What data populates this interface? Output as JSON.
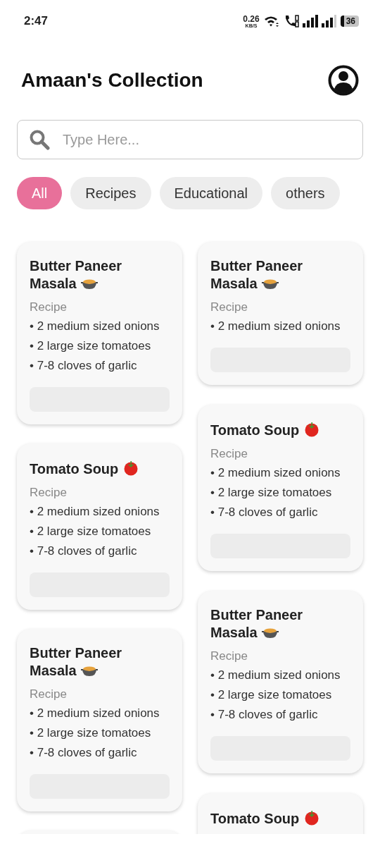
{
  "status_bar": {
    "time": "2:47",
    "speed": "0.26",
    "speed_unit": "KB/S",
    "battery": "36"
  },
  "header": {
    "title": "Amaan's Collection"
  },
  "search": {
    "placeholder": "Type Here..."
  },
  "filters": [
    {
      "label": "All",
      "selected": true
    },
    {
      "label": "Recipes",
      "selected": false
    },
    {
      "label": "Educational",
      "selected": false
    },
    {
      "label": "others",
      "selected": false
    }
  ],
  "columns": [
    [
      {
        "title": "Butter Paneer Masala",
        "kind": "pot",
        "category": "Recipe",
        "ingredients": [
          "• 2 medium sized onions",
          "• 2 large size tomatoes",
          "• 7-8 cloves of garlic"
        ]
      },
      {
        "title": "Tomato Soup",
        "kind": "tomato",
        "category": "Recipe",
        "ingredients": [
          "• 2 medium sized onions",
          "• 2 large size tomatoes",
          "• 7-8 cloves of garlic"
        ]
      },
      {
        "title": "Butter Paneer Masala",
        "kind": "pot",
        "category": "Recipe",
        "ingredients": [
          "• 2 medium sized onions",
          "• 2 large size tomatoes",
          "• 7-8 cloves of garlic"
        ]
      },
      {}
    ],
    [
      {
        "title": "Butter Paneer Masala",
        "kind": "pot",
        "category": "Recipe",
        "ingredients": [
          "• 2 medium sized onions"
        ]
      },
      {
        "title": "Tomato Soup",
        "kind": "tomato",
        "category": "Recipe",
        "ingredients": [
          "• 2 medium sized onions",
          "• 2 large size tomatoes",
          "• 7-8 cloves of garlic"
        ]
      },
      {
        "title": "Butter Paneer Masala",
        "kind": "pot",
        "category": "Recipe",
        "ingredients": [
          "• 2 medium sized onions",
          "• 2 large size tomatoes",
          "• 7-8 cloves of garlic"
        ]
      },
      {
        "title": "Tomato Soup",
        "kind": "tomato"
      }
    ]
  ]
}
